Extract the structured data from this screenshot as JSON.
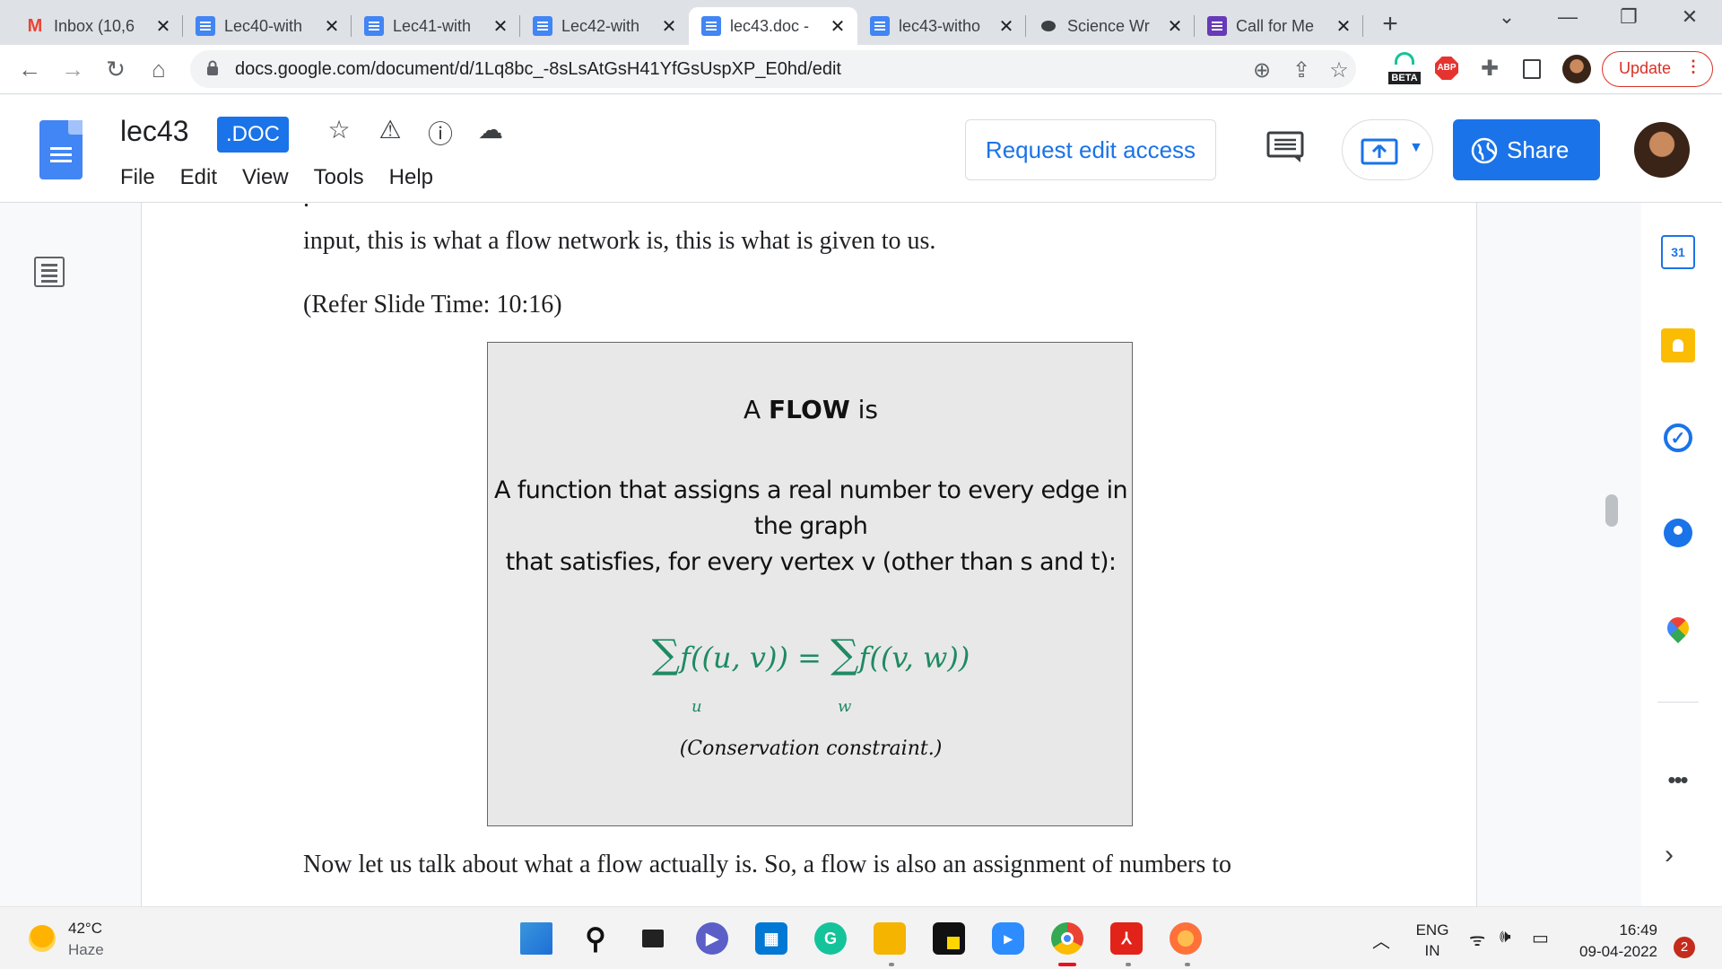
{
  "browser": {
    "tabs": [
      {
        "title": "Inbox (10,6",
        "icon": "gmail-icon"
      },
      {
        "title": "Lec40-with",
        "icon": "docs-icon"
      },
      {
        "title": "Lec41-with",
        "icon": "docs-icon"
      },
      {
        "title": "Lec42-with",
        "icon": "docs-icon"
      },
      {
        "title": "lec43.doc -",
        "icon": "docs-icon",
        "active": true
      },
      {
        "title": "lec43-witho",
        "icon": "docs-icon"
      },
      {
        "title": "Science Wr",
        "icon": "chat-icon"
      },
      {
        "title": "Call for Me",
        "icon": "forms-icon"
      }
    ],
    "new_tab": "+",
    "url": "docs.google.com/document/d/1Lq8bc_-8sLsAtGsH41YfGsUspXP_E0hd/edit",
    "ext_beta": "BETA",
    "ext_abp": "ABP",
    "update_label": "Update"
  },
  "docs": {
    "title": "lec43",
    "badge": ".DOC",
    "menu": [
      "File",
      "Edit",
      "View",
      "Tools",
      "Help"
    ],
    "request_access": "Request edit access",
    "share": "Share"
  },
  "document": {
    "line1": "input, this is what a flow network is, this is what is given to us.",
    "line2": "(Refer Slide Time: 10:16)",
    "line3": "Now let us talk about what a flow actually is. So, a flow is also an assignment of numbers to",
    "slide": {
      "title_pre": "A ",
      "title_bold": "FLOW",
      "title_post": " is",
      "body_line1": "A function that assigns a real number to every edge in the graph",
      "body_line2": "that satisfies, for every vertex v (other than s and t):",
      "formula_left": "f((u, v)) = ",
      "formula_right": "f((v, w))",
      "sigma": "∑",
      "sub_u": "u",
      "sub_w": "w",
      "note": "(Conservation constraint.)"
    }
  },
  "side_panel": {
    "calendar_label": "31",
    "more": "•••"
  },
  "taskbar": {
    "temp": "42°C",
    "weather": "Haze",
    "lang_line1": "ENG",
    "lang_line2": "IN",
    "time": "16:49",
    "date": "09-04-2022",
    "notifications": "2"
  },
  "colors": {
    "accent": "#1a73e8",
    "update_red": "#d93025",
    "formula_green": "#1e8a63"
  }
}
